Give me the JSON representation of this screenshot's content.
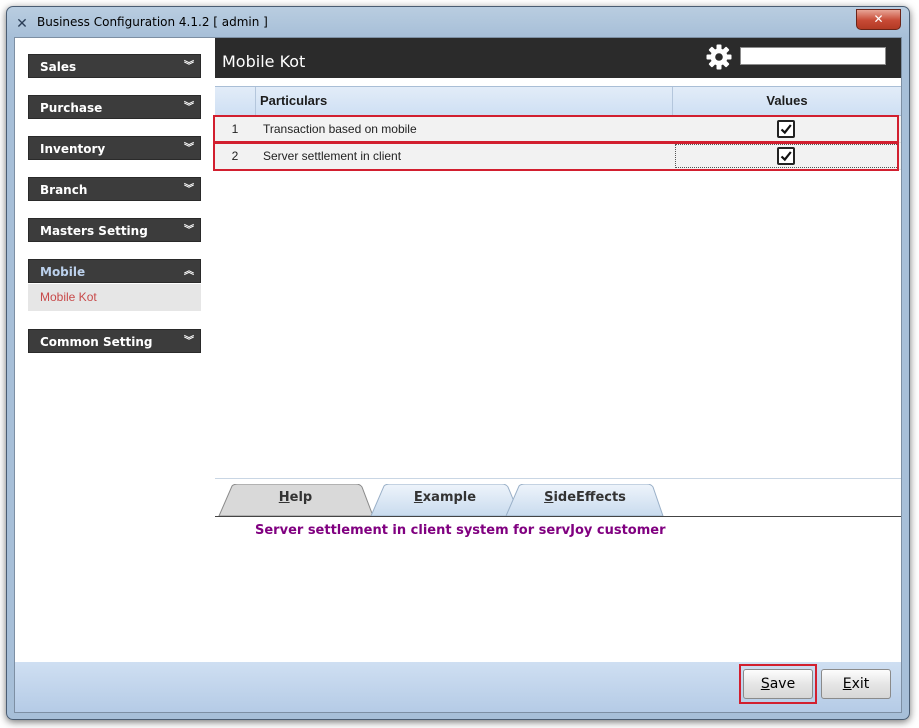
{
  "window": {
    "title": "Business Configuration 4.1.2 [ admin ]",
    "close_label": "✕"
  },
  "sidebar": {
    "sections": [
      {
        "label": "Sales",
        "chevron": "»"
      },
      {
        "label": "Purchase",
        "chevron": "»"
      },
      {
        "label": "Inventory",
        "chevron": "»"
      },
      {
        "label": "Branch",
        "chevron": "»"
      },
      {
        "label": "Masters Setting",
        "chevron": "»"
      },
      {
        "label": "Mobile",
        "chevron": "«",
        "expanded": true,
        "items": [
          "Mobile Kot"
        ]
      },
      {
        "label": "Common Setting",
        "chevron": "»"
      }
    ]
  },
  "main": {
    "title": "Mobile Kot",
    "search": {
      "value": "",
      "placeholder": ""
    },
    "grid": {
      "columns": [
        "",
        "Particulars",
        "Values"
      ],
      "rows": [
        {
          "index": "1",
          "particular": "Transaction based on mobile",
          "checked": true
        },
        {
          "index": "2",
          "particular": "Server settlement in client",
          "checked": true
        }
      ]
    },
    "tabs": [
      {
        "label": "Help",
        "mnemonic": "H",
        "rest": "elp"
      },
      {
        "label": "Example",
        "mnemonic": "E",
        "rest": "xample"
      },
      {
        "label": "SideEffects",
        "mnemonic": "S",
        "rest": "ideEffects"
      }
    ],
    "description": "Server settlement in client system for servJoy customer"
  },
  "buttons": {
    "save": {
      "mnemonic": "S",
      "rest": "ave"
    },
    "exit": {
      "mnemonic": "E",
      "rest": "xit"
    }
  },
  "colors": {
    "highlight": "#d21f2f",
    "sidebar_header": "#3c3c3c",
    "active_item": "#c84a4a",
    "description": "#800080"
  }
}
